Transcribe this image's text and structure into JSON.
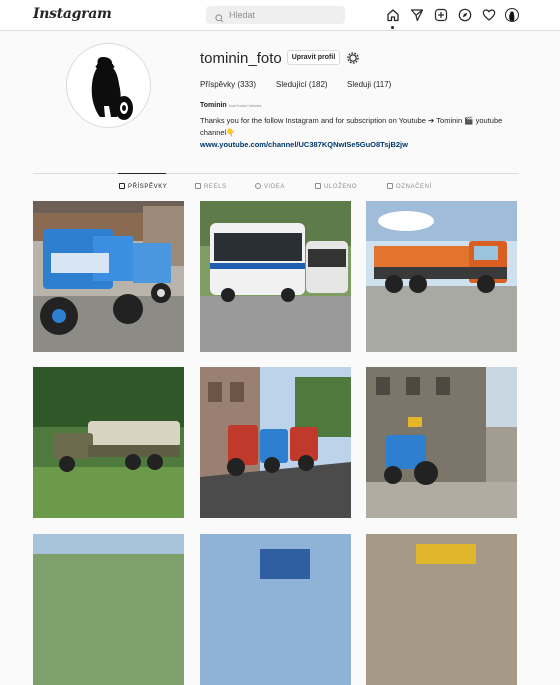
{
  "header": {
    "logo": "Instagram",
    "search_placeholder": "Hledat"
  },
  "profile": {
    "username": "tominin_foto",
    "edit_button": "Upravit profil",
    "stats": {
      "posts": "Příspěvky (333)",
      "followers": "Sledující (182)",
      "following": "Sleduji (117)"
    },
    "display_name": "Tominin",
    "display_name_sub": "truck\"tractor\"vehicles",
    "bio_text": "Thanks you for the follow Instagram and for subscription on Youtube ➔ Tominin 🎬 youtube channel👇",
    "link": "www.youtube.com/channel/UC387KQNwISe5GuO8TsjB2jw"
  },
  "tabs": [
    {
      "label": "PŘÍSPĚVKY",
      "active": true
    },
    {
      "label": "REELS",
      "active": false
    },
    {
      "label": "VIDEA",
      "active": false
    },
    {
      "label": "ULOŽENO",
      "active": false
    },
    {
      "label": "OZNAČENÍ",
      "active": false
    }
  ],
  "posts": [
    {
      "subject": "blue tractors by a building"
    },
    {
      "subject": "white and blue buses on a road"
    },
    {
      "subject": "orange dump truck"
    },
    {
      "subject": "military truck in a field"
    },
    {
      "subject": "tractors parade on a town street"
    },
    {
      "subject": "blue tractor with flag by a tower"
    },
    {
      "subject": "partially visible post"
    },
    {
      "subject": "partially visible post"
    },
    {
      "subject": "partially visible post"
    }
  ],
  "colors": {
    "link": "#00376b",
    "border": "#dbdbdb",
    "muted": "#8e8e8e"
  }
}
